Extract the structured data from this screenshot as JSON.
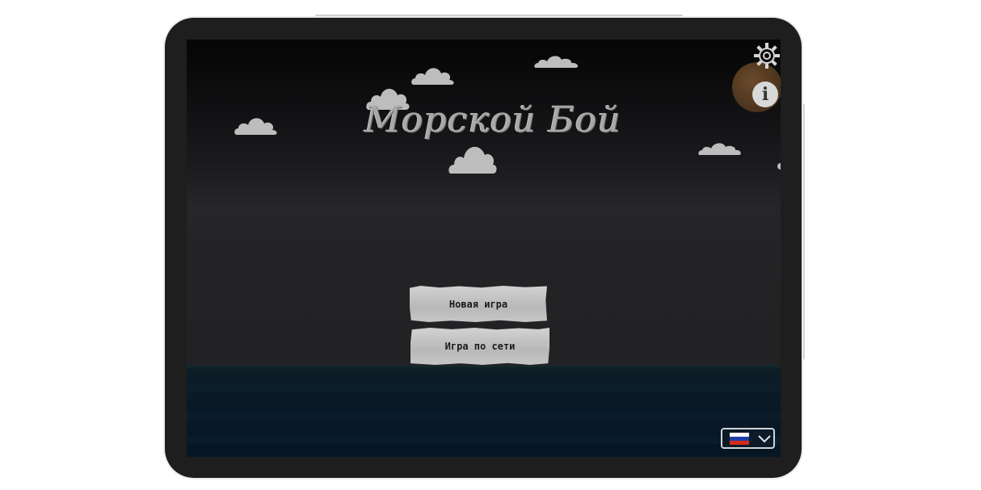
{
  "game": {
    "title": "Морской Бой",
    "menu": {
      "new_game": "Новая игра",
      "network_game": "Игра по сети"
    },
    "info_label": "i"
  },
  "language_select": {
    "flag_colors": [
      "#ffffff",
      "#1c3fa8",
      "#d52b1e"
    ]
  },
  "icons": {
    "settings": "gear-icon",
    "info": "info-icon",
    "dropdown": "chevron-down-icon",
    "flag": "russia-flag-icon"
  },
  "colors": {
    "sky_top": "#050505",
    "sky_bottom": "#232326",
    "sea": "#0a1b27",
    "button_paper": "#c4c4c4",
    "cloud": "#bdbdbd",
    "title": "#a8a8a8"
  }
}
